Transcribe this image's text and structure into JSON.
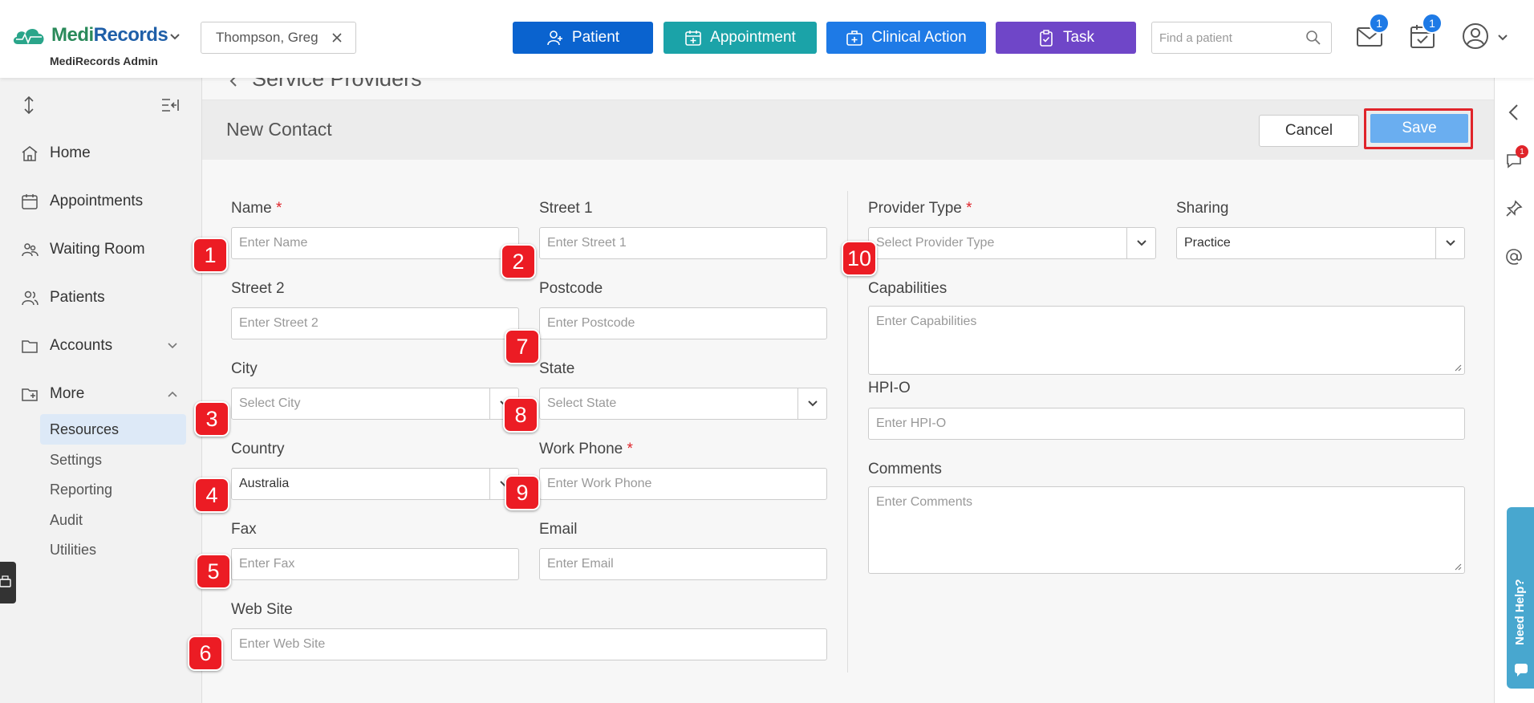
{
  "app": {
    "brand_prefix": "Medi",
    "brand_suffix": "Records",
    "subtitle": "MediRecords Admin"
  },
  "topbar": {
    "current_patient": "Thompson, Greg",
    "buttons": [
      {
        "label": "Patient",
        "color": "#0a63cf"
      },
      {
        "label": "Appointment",
        "color": "#1ba3a8"
      },
      {
        "label": "Clinical Action",
        "color": "#1e7ae6"
      },
      {
        "label": "Task",
        "color": "#6f46c8"
      }
    ],
    "search_placeholder": "Find a patient",
    "mail_badge": "1",
    "calendar_badge": "1"
  },
  "sidebar": {
    "items": [
      {
        "label": "Home",
        "icon": "home-icon"
      },
      {
        "label": "Appointments",
        "icon": "calendar-icon"
      },
      {
        "label": "Waiting Room",
        "icon": "people-icon"
      },
      {
        "label": "Patients",
        "icon": "users-icon"
      },
      {
        "label": "Accounts",
        "icon": "folder-icon"
      },
      {
        "label": "More",
        "icon": "folder-plus-icon"
      }
    ],
    "sub_items": [
      "Resources",
      "Settings",
      "Reporting",
      "Audit",
      "Utilities"
    ],
    "active_sub_item": "Resources"
  },
  "page": {
    "breadcrumb": "Service Providers",
    "title": "New Contact",
    "cancel_label": "Cancel",
    "save_label": "Save"
  },
  "form": {
    "name": {
      "label": "Name",
      "required": "*",
      "placeholder": "Enter Name"
    },
    "street1": {
      "label": "Street 1",
      "placeholder": "Enter Street 1"
    },
    "street2": {
      "label": "Street 2",
      "placeholder": "Enter Street 2"
    },
    "postcode": {
      "label": "Postcode",
      "placeholder": "Enter Postcode"
    },
    "city": {
      "label": "City",
      "placeholder": "Select City"
    },
    "state": {
      "label": "State",
      "placeholder": "Select State"
    },
    "country": {
      "label": "Country",
      "value": "Australia"
    },
    "work_phone": {
      "label": "Work Phone",
      "required": "*",
      "placeholder": "Enter Work Phone"
    },
    "fax": {
      "label": "Fax",
      "placeholder": "Enter Fax"
    },
    "email": {
      "label": "Email",
      "placeholder": "Enter Email"
    },
    "website": {
      "label": "Web Site",
      "placeholder": "Enter Web Site"
    },
    "provider_type": {
      "label": "Provider Type",
      "required": "*",
      "placeholder": "Select Provider Type"
    },
    "sharing": {
      "label": "Sharing",
      "value": "Practice"
    },
    "capabilities": {
      "label": "Capabilities",
      "placeholder": "Enter Capabilities"
    },
    "hpio": {
      "label": "HPI-O",
      "placeholder": "Enter HPI-O"
    },
    "comments": {
      "label": "Comments",
      "placeholder": "Enter Comments"
    }
  },
  "markers": [
    "1",
    "2",
    "3",
    "4",
    "5",
    "6",
    "7",
    "8",
    "9",
    "10"
  ],
  "right_rail": {
    "chat_badge": "1"
  },
  "help": {
    "label": "Need Help?"
  }
}
